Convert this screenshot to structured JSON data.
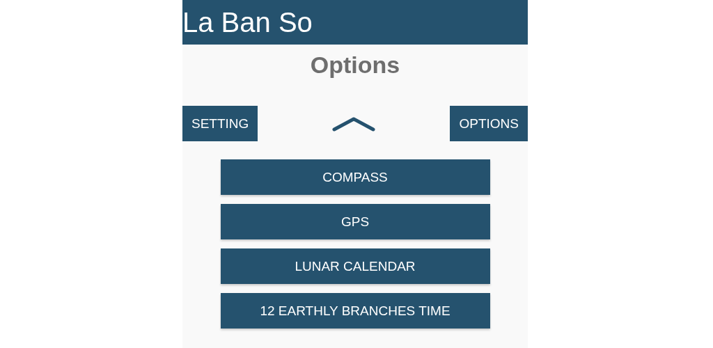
{
  "app_bar": {
    "title": "La Ban So"
  },
  "heading": "Options",
  "toolbar": {
    "left_button": "SETTING",
    "right_button": "OPTIONS"
  },
  "menu_items": [
    {
      "label": "COMPASS"
    },
    {
      "label": "GPS"
    },
    {
      "label": "LUNAR CALENDAR"
    },
    {
      "label": "12 EARTHLY BRANCHES TIME"
    }
  ]
}
